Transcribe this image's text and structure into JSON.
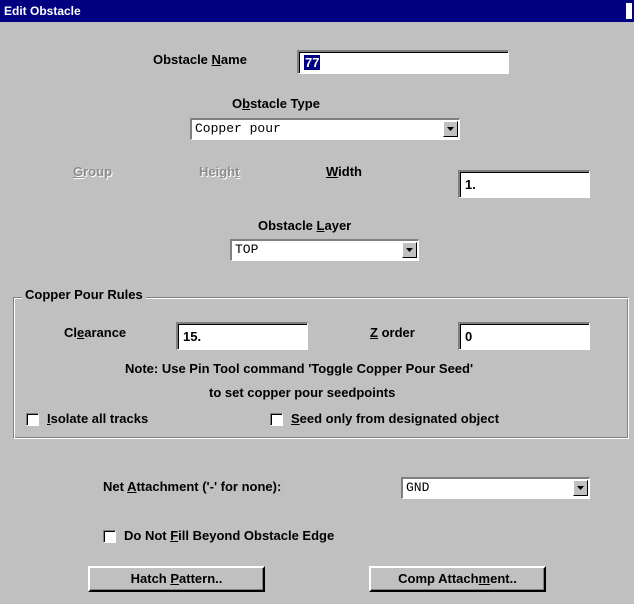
{
  "window": {
    "title": "Edit Obstacle"
  },
  "obstacle_name": {
    "label_pre": "Obstacle ",
    "label_key": "N",
    "label_post": "ame",
    "value": "77"
  },
  "obstacle_type": {
    "label_pre": "O",
    "label_key": "b",
    "label_post": "stacle Type",
    "selected": "Copper pour"
  },
  "group": {
    "label_key": "G",
    "label_post": "roup"
  },
  "height": {
    "label_pre": "Heigh",
    "label_key": "t"
  },
  "width": {
    "label_key": "W",
    "label_post": "idth",
    "value": "1."
  },
  "obstacle_layer": {
    "label_pre": "Obstacle ",
    "label_key": "L",
    "label_post": "ayer",
    "selected": "TOP"
  },
  "copper_pour_rules": {
    "title": "Copper Pour Rules",
    "clearance": {
      "label_pre": "Cl",
      "label_key": "e",
      "label_post": "arance",
      "value": "15."
    },
    "z_order": {
      "label_key": "Z",
      "label_post": " order",
      "value": "0"
    },
    "note_line1": "Note: Use Pin Tool command 'Toggle Copper Pour Seed'",
    "note_line2": "to set copper pour seedpoints",
    "isolate": {
      "label_key": "I",
      "label_post": "solate all tracks"
    },
    "seed": {
      "label_key": "S",
      "label_post": "eed only from designated object"
    }
  },
  "net_attachment": {
    "label_pre": "Net ",
    "label_key": "A",
    "label_post": "ttachment ('-' for none):",
    "selected": "GND"
  },
  "do_not_fill": {
    "label_pre": "Do Not ",
    "label_key": "F",
    "label_post": "ill Beyond Obstacle Edge"
  },
  "buttons": {
    "hatch": {
      "pre": "Hatch ",
      "key": "P",
      "post": "attern.."
    },
    "comp": {
      "pre": "Comp Attach",
      "key": "m",
      "post": "ent.."
    }
  }
}
